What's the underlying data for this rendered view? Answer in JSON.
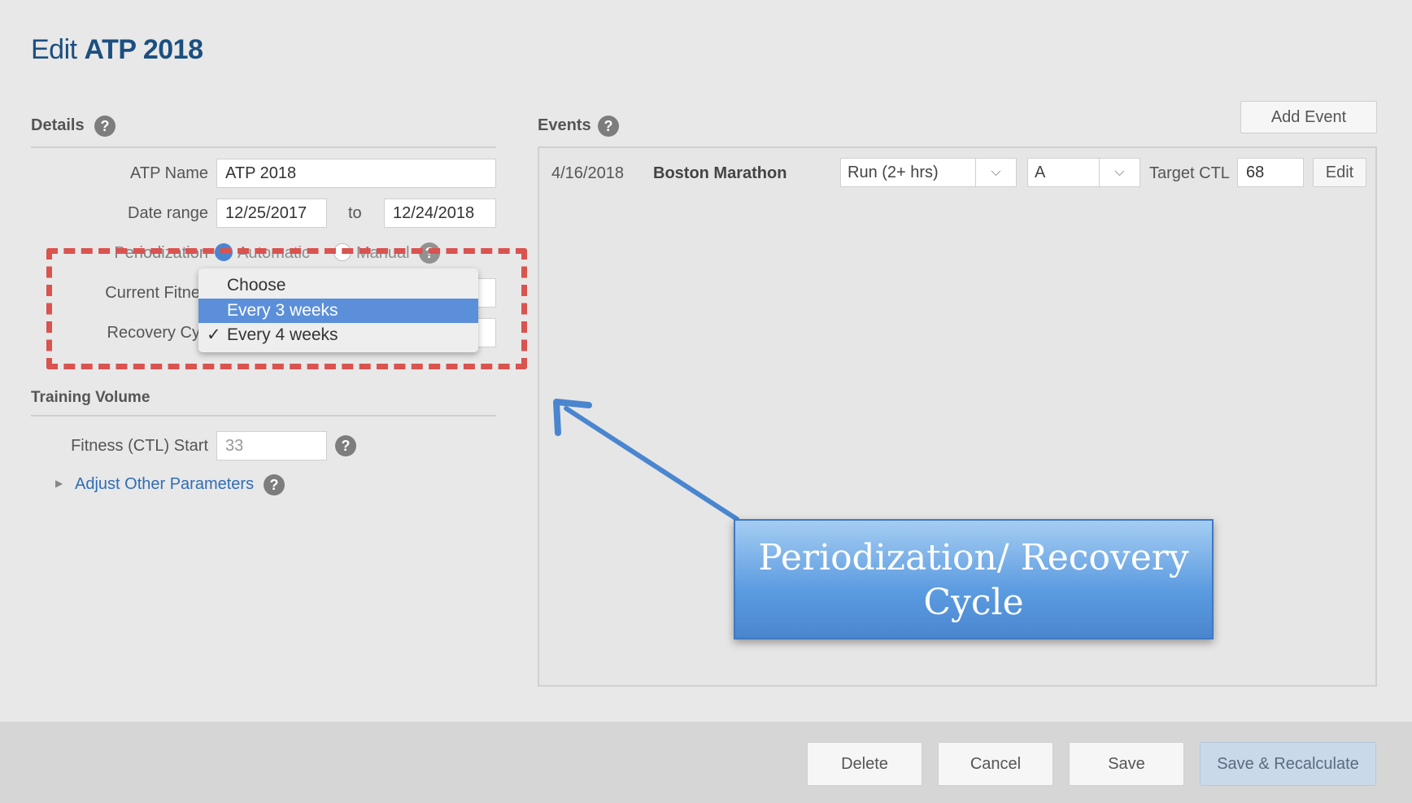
{
  "header": {
    "prefix": "Edit",
    "name": "ATP 2018"
  },
  "details": {
    "heading": "Details",
    "atp_name_label": "ATP Name",
    "atp_name_value": "ATP 2018",
    "date_range_label": "Date range",
    "date_start": "12/25/2017",
    "date_to": "to",
    "date_end": "12/24/2018",
    "periodization_label": "Periodization",
    "periodization_automatic": "Automatic",
    "periodization_manual": "Manual",
    "current_fitness_label": "Current Fitnes",
    "recovery_cycle_label": "Recovery Cyc"
  },
  "dropdown": {
    "options": [
      "Choose",
      "Every 3 weeks",
      "Every 4 weeks"
    ],
    "checkmark": "✓"
  },
  "training": {
    "heading": "Training Volume",
    "ctl_start_label": "Fitness (CTL) Start",
    "ctl_start_value": "33",
    "adjust_link": "Adjust Other Parameters"
  },
  "events": {
    "heading": "Events",
    "add_button": "Add Event",
    "rows": [
      {
        "date": "4/16/2018",
        "name": "Boston Marathon",
        "type": "Run (2+ hrs)",
        "priority": "A",
        "target_label": "Target CTL",
        "target_value": "68",
        "edit_label": "Edit"
      }
    ]
  },
  "callout": {
    "line1": "Periodization/ Recovery",
    "line2": "Cycle"
  },
  "footer": {
    "delete": "Delete",
    "cancel": "Cancel",
    "save": "Save",
    "save_recalc": "Save & Recalculate"
  },
  "icons": {
    "help": "?",
    "caret": "⌵",
    "triangle": "▶"
  },
  "colors": {
    "accent": "#1b4f80",
    "link": "#2f6db5",
    "highlight": "#d9534f",
    "callout": "#5b9be0"
  }
}
